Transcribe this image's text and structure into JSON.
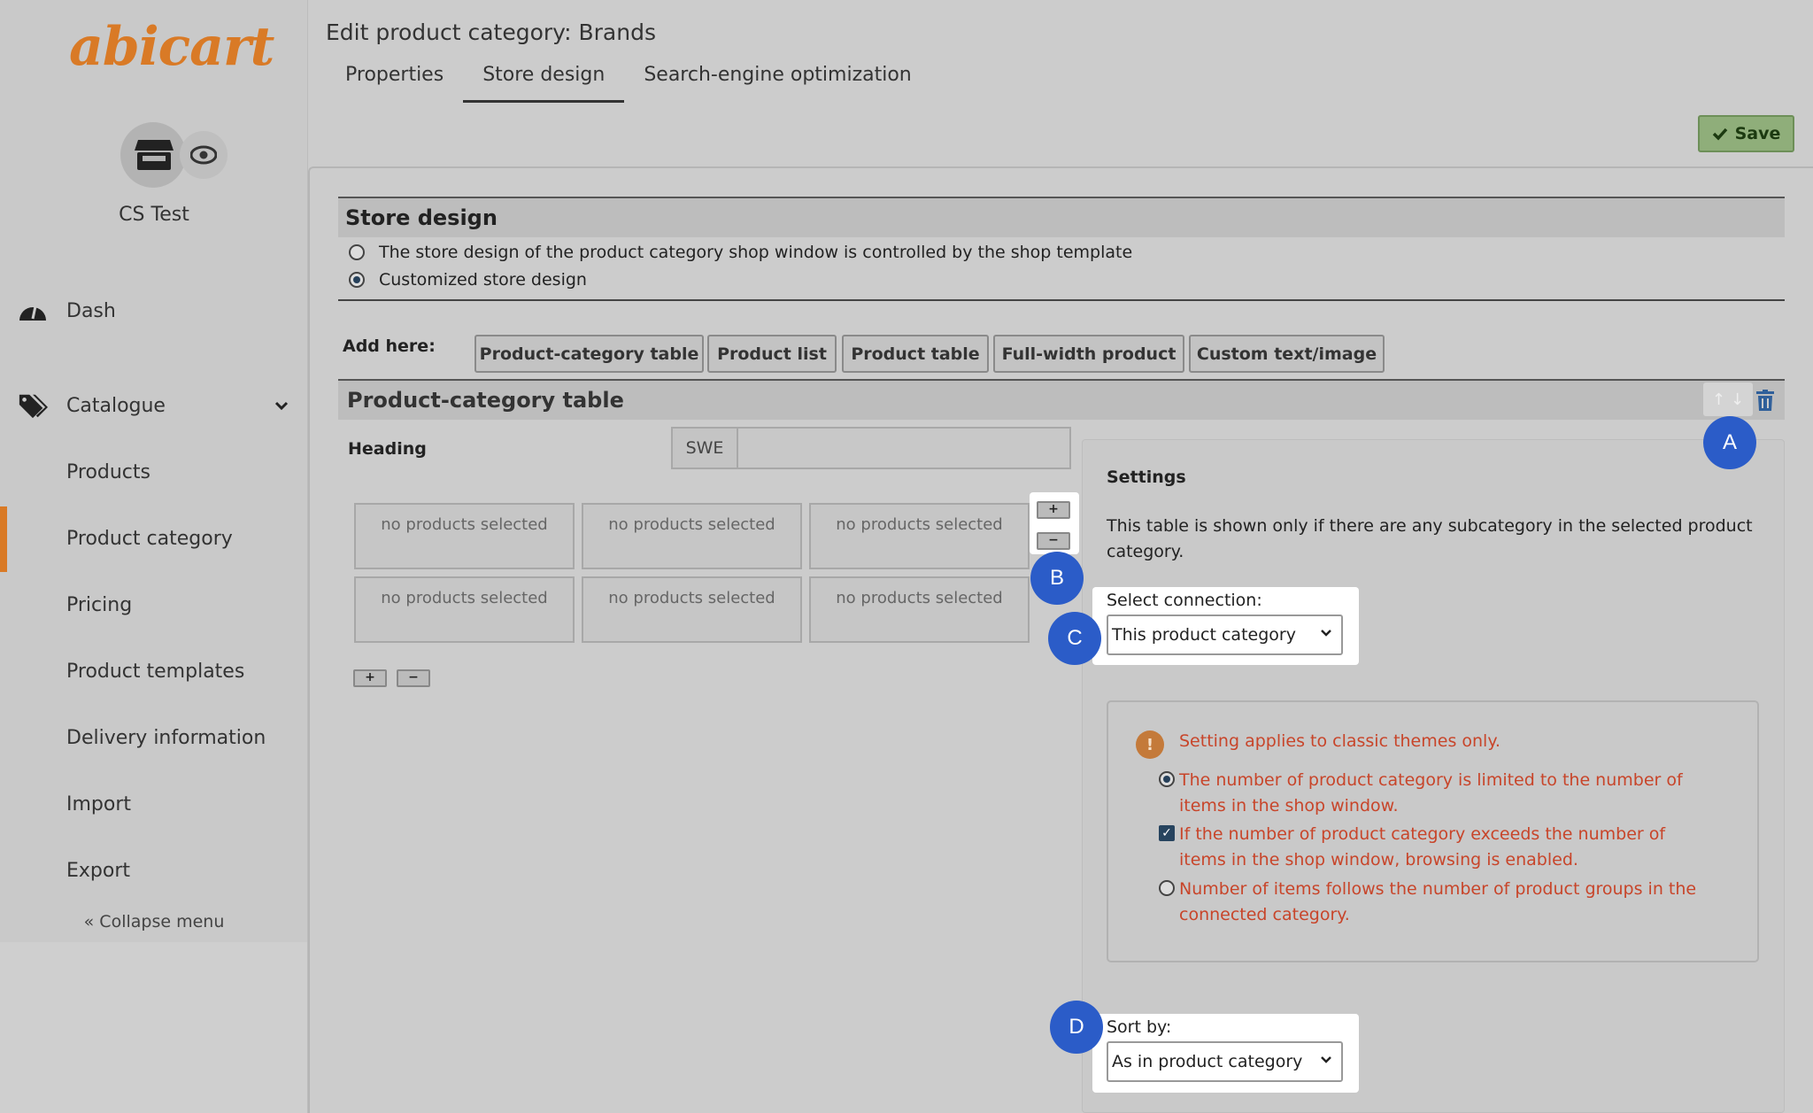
{
  "brand": {
    "logo_text": "abicart",
    "logo_color": "#d97a26"
  },
  "shop": {
    "name": "CS Test"
  },
  "sidebar": {
    "items": [
      {
        "label": "Dash",
        "icon": "dashboard-icon"
      },
      {
        "label": "Catalogue",
        "icon": "tags-icon",
        "expandable": true
      },
      {
        "label": "Products"
      },
      {
        "label": "Product category",
        "active": true
      },
      {
        "label": "Pricing"
      },
      {
        "label": "Product templates"
      },
      {
        "label": "Delivery information"
      },
      {
        "label": "Import"
      },
      {
        "label": "Export"
      }
    ],
    "collapse_label": "Collapse menu"
  },
  "header": {
    "title": "Edit product category: Brands",
    "tabs": [
      {
        "label": "Properties"
      },
      {
        "label": "Store design",
        "active": true
      },
      {
        "label": "Search-engine optimization"
      }
    ],
    "save_label": "Save"
  },
  "store_design": {
    "heading": "Store design",
    "options": [
      {
        "label": "The store design of the product category shop window is controlled by the shop template",
        "selected": false
      },
      {
        "label": "Customized store design",
        "selected": true
      }
    ],
    "add_here_label": "Add here:",
    "add_buttons": [
      "Product-category table",
      "Product list",
      "Product table",
      "Full-width product",
      "Custom text/image"
    ]
  },
  "block": {
    "title": "Product-category table",
    "heading_label": "Heading",
    "language": "SWE",
    "heading_value": "",
    "cells": [
      "no products selected",
      "no products selected",
      "no products selected",
      "no products selected",
      "no products selected",
      "no products selected"
    ],
    "add_symbol": "+",
    "remove_symbol": "−"
  },
  "settings": {
    "title": "Settings",
    "description": "This table is shown only if there are any subcategory in the selected product category.",
    "connection_label": "Select connection:",
    "connection_value": "This product category",
    "warning_symbol": "!",
    "warning": "Setting applies to classic themes only.",
    "option_limit": "The number of product category is limited to the number of items in the shop window.",
    "option_browse": "If the number of product category exceeds the number of items in the shop window, browsing is enabled.",
    "option_follow": "Number of items follows the number of product groups in the connected category.",
    "sort_label": "Sort by:",
    "sort_value": "As in product category"
  },
  "callouts": [
    "A",
    "B",
    "C",
    "D"
  ],
  "colors": {
    "accent": "#d97a26",
    "callout": "#2b5cc8",
    "warning": "#c8452a",
    "save": "#8fae7a"
  }
}
